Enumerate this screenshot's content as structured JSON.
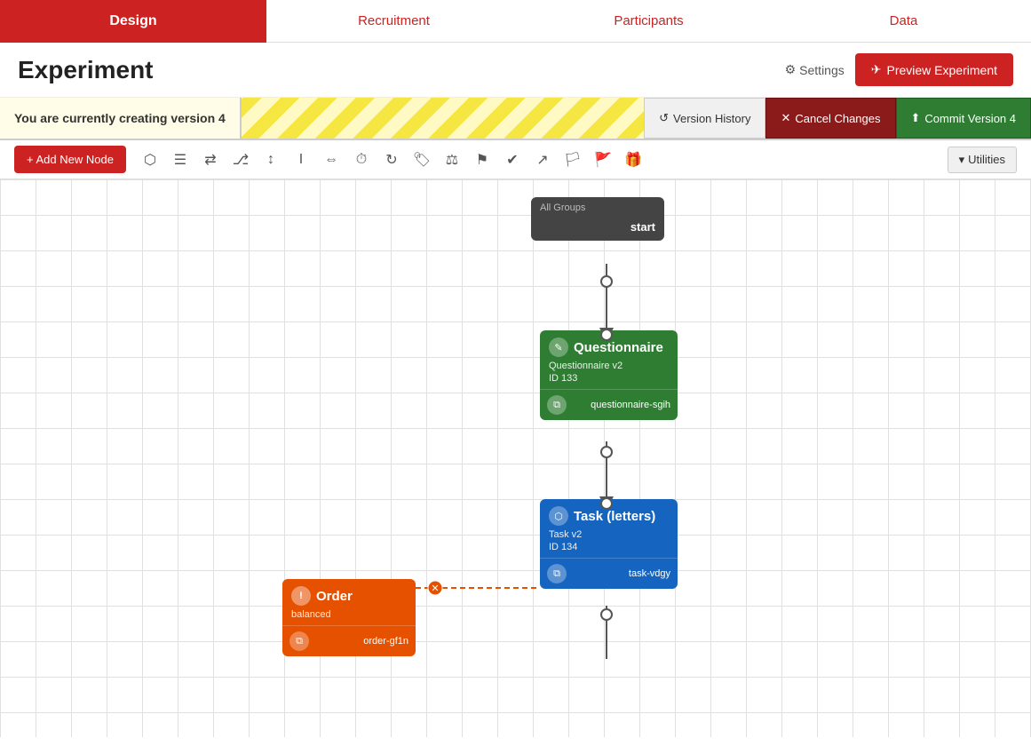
{
  "nav": {
    "design": "Design",
    "recruitment": "Recruitment",
    "participants": "Participants",
    "data": "Data"
  },
  "header": {
    "title": "Experiment",
    "settings_label": "Settings",
    "preview_label": "Preview Experiment"
  },
  "version_banner": {
    "text": "You are currently creating version 4",
    "version_history": "Version History",
    "cancel_changes": "Cancel Changes",
    "commit": "Commit Version 4"
  },
  "toolbar": {
    "add_node": "+ Add New Node",
    "utilities": "Utilities"
  },
  "nodes": {
    "start": {
      "group": "All Groups",
      "label": "start"
    },
    "questionnaire": {
      "title": "Questionnaire",
      "subtitle": "Questionnaire v2",
      "id": "ID 133",
      "tag": "questionnaire-sgih"
    },
    "task": {
      "title": "Task (letters)",
      "subtitle": "Task v2",
      "id": "ID 134",
      "tag": "task-vdgy"
    },
    "order": {
      "title": "Order",
      "subtitle": "balanced",
      "tag": "order-gf1n"
    }
  }
}
